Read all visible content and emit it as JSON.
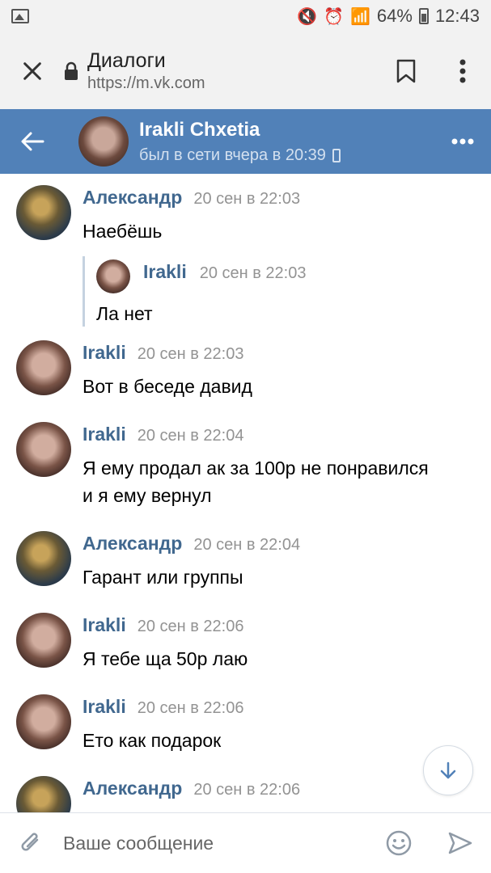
{
  "status_bar": {
    "battery": "64%",
    "time": "12:43"
  },
  "browser": {
    "title": "Диалоги",
    "url": "https://m.vk.com"
  },
  "chat_header": {
    "name": "Irakli Chxetia",
    "status": "был в сети вчера в 20:39"
  },
  "messages": [
    {
      "author": "Александр",
      "time": "20 сен в 22:03",
      "text": "Наебёшь",
      "avatar": "alex",
      "forwarded": {
        "author": "Irakli",
        "time": "20 сен в 22:03",
        "text": "Ла нет"
      }
    },
    {
      "author": "Irakli",
      "time": "20 сен в 22:03",
      "text": "Вот в беседе давид",
      "avatar": "irakli"
    },
    {
      "author": "Irakli",
      "time": "20 сен в 22:04",
      "text_line1": "Я ему продал ак за 100р не понравился",
      "text_line2": "и я ему вернул",
      "avatar": "irakli"
    },
    {
      "author": "Александр",
      "time": "20 сен в 22:04",
      "text": "Гарант или группы",
      "avatar": "alex"
    },
    {
      "author": "Irakli",
      "time": "20 сен в 22:06",
      "text": "Я тебе ща 50р лаю",
      "avatar": "irakli"
    },
    {
      "author": "Irakli",
      "time": "20 сен в 22:06",
      "text": "Ето как подарок",
      "avatar": "irakli"
    },
    {
      "author": "Александр",
      "time": "20 сен в 22:06",
      "text": "",
      "avatar": "alex"
    }
  ],
  "composer": {
    "placeholder": "Ваше сообщение"
  },
  "icons": {
    "close": "close-icon",
    "lock": "lock-icon",
    "bookmark": "bookmark-icon",
    "menu": "more-vertical-icon",
    "back": "arrow-left-icon",
    "more": "more-horizontal-icon",
    "attach": "paperclip-icon",
    "emoji": "smile-icon",
    "send": "send-icon",
    "scroll_down": "arrow-down-icon"
  },
  "colors": {
    "vk_header": "#5181b8",
    "author_link": "#41688f",
    "meta_text": "#939393"
  }
}
